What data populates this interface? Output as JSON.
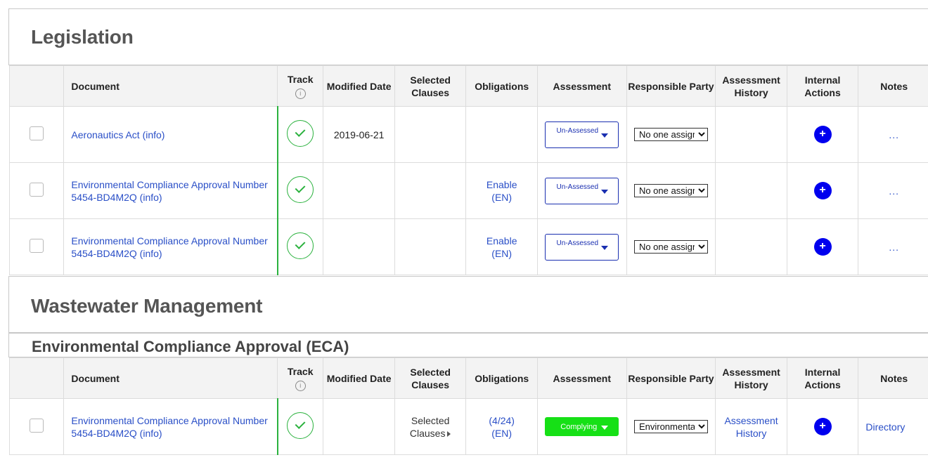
{
  "sections": [
    {
      "title": "Legislation",
      "rows": [
        {
          "document": "Aeronautics Act (info)",
          "modified": "2019-06-21",
          "selected_clauses": "",
          "obligations": "",
          "assessment": "Un-Assessed",
          "party": "No one assigned",
          "history": "",
          "notes": "..."
        },
        {
          "document": "Environmental Compliance Approval Number 5454-BD4M2Q (info)",
          "modified": "",
          "selected_clauses": "",
          "obligations": "Enable (EN)",
          "assessment": "Un-Assessed",
          "party": "No one assigned",
          "history": "",
          "notes": "..."
        },
        {
          "document": "Environmental Compliance Approval Number 5454-BD4M2Q (info)",
          "modified": "",
          "selected_clauses": "",
          "obligations": "Enable (EN)",
          "assessment": "Un-Assessed",
          "party": "No one assigned",
          "history": "",
          "notes": "..."
        }
      ]
    },
    {
      "title": "Wastewater Management",
      "subtitle": "Environmental Compliance Approval (ECA)",
      "rows": [
        {
          "document": "Environmental Compliance Approval Number 5454-BD4M2Q (info)",
          "modified": "",
          "selected_clauses": "Selected Clauses",
          "obligations": "(4/24) (EN)",
          "assessment": "Complying",
          "party": "Environmental",
          "history": "Assessment History",
          "notes": "Directory"
        }
      ]
    }
  ],
  "columns": {
    "document": "Document",
    "track": "Track",
    "modified": "Modified Date",
    "selected_clauses": "Selected Clauses",
    "obligations": "Obligations",
    "assessment": "Assessment",
    "party": "Responsible Party",
    "history": "Assessment History",
    "internal_actions": "Internal Actions",
    "notes": "Notes"
  },
  "icons": {
    "track": "check-circle-icon",
    "info": "info-icon",
    "add": "plus-icon"
  },
  "colors": {
    "link": "#2a4fc7",
    "track_green": "#2bb23e",
    "assess_border": "#1a2fb0",
    "complying": "#16e016",
    "add_button": "#0000ee"
  }
}
